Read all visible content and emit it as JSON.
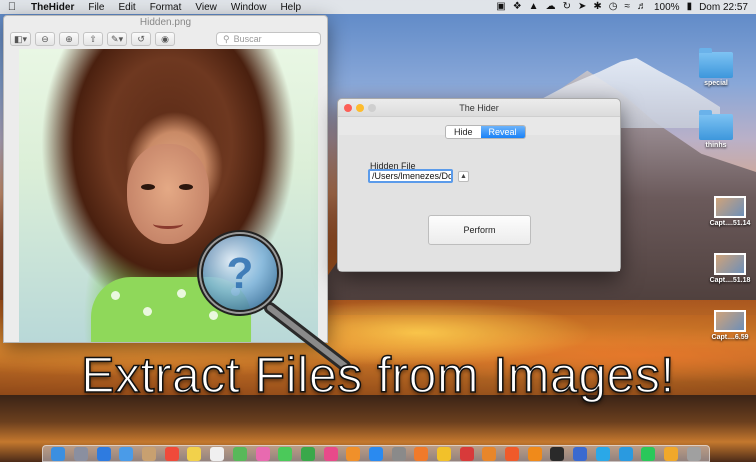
{
  "menubar": {
    "apple": "",
    "app_name": "TheHider",
    "menus": [
      "File",
      "Edit",
      "Format",
      "View",
      "Window",
      "Help"
    ],
    "battery": "100%",
    "clock": "Dom 22:57"
  },
  "preview": {
    "title": "Hidden.png",
    "search_placeholder": "Buscar"
  },
  "hider": {
    "title": "The Hider",
    "segments": [
      "Hide",
      "Reveal"
    ],
    "selected_segment": "Reveal",
    "field_label": "Hidden File",
    "path_value": "/Users/lmenezes/Dow",
    "perform_label": "Perform"
  },
  "desktop": {
    "items": [
      {
        "label": "special",
        "kind": "folder"
      },
      {
        "label": "thinhs",
        "kind": "folder"
      },
      {
        "label": "Capt....51.14",
        "kind": "screenshot"
      },
      {
        "label": "Capt....51.18",
        "kind": "screenshot"
      },
      {
        "label": "Capt....6.59",
        "kind": "screenshot"
      }
    ]
  },
  "caption": "Extract Files from Images!",
  "dock": {
    "icons": [
      "finder-icon",
      "launchpad-icon",
      "safari-icon",
      "mail-icon",
      "contacts-icon",
      "calendar-icon",
      "notes-icon",
      "reminders-icon",
      "maps-icon",
      "photos-icon",
      "messages-icon",
      "facetime-icon",
      "itunes-icon",
      "ibooks-icon",
      "appstore-icon",
      "preferences-icon",
      "firefox-icon",
      "chrome-icon",
      "opera-icon",
      "sublime-icon",
      "brave-icon",
      "vlc-icon",
      "terminal-icon",
      "xcode-icon",
      "skype-icon",
      "telegram-icon",
      "whatsapp-icon",
      "sketch-icon",
      "trash-icon"
    ]
  },
  "colors": {
    "accent": "#1a82f7",
    "close": "#fc5f57",
    "minimize": "#fdbc2e",
    "folder": "#3d97dc"
  }
}
